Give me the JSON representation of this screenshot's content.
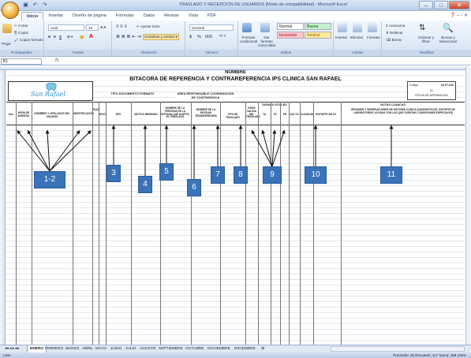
{
  "window": {
    "title": "TRASLADO Y RECEPCION DE USUARIOS [Modo de compatibilidad] - Microsoft Excel",
    "minimize": "–",
    "maximize": "□",
    "close": "✕"
  },
  "ribbon_tabs": [
    "Inicio",
    "Insertar",
    "Diseño de página",
    "Fórmulas",
    "Datos",
    "Revisar",
    "Vista",
    "PDF"
  ],
  "ribbon": {
    "clipboard": {
      "paste": "Pegar",
      "cut": "Cortar",
      "copy": "Copiar",
      "format_painter": "Copiar formato",
      "label": "Portapapeles"
    },
    "font": {
      "name": "Arial",
      "size": "10",
      "bold": "N",
      "italic": "K",
      "underline": "S",
      "label": "Fuente"
    },
    "alignment": {
      "wrap": "Ajustar texto",
      "merge": "Combinar y centrar",
      "label": "Alineación"
    },
    "number": {
      "format": "General",
      "currency": "$",
      "percent": "%",
      "thousands": "000",
      "label": "Número"
    },
    "styles": {
      "conditional": "Formato condicional",
      "as_table": "Dar formato como tabla",
      "normal": "Normal",
      "good": "Buena",
      "bad": "Incorrecto",
      "neutral": "Neutral",
      "label": "Estilos"
    },
    "cells": {
      "insert": "Insertar",
      "delete": "Eliminar",
      "format": "Formato",
      "label": "Celdas"
    },
    "editing": {
      "autosum": "Autosuma",
      "fill": "Rellenar",
      "clear": "Borrar",
      "sort": "Ordenar y filtrar",
      "find": "Buscar y seleccionar",
      "label": "Modificar"
    }
  },
  "formula_bar": {
    "cell": "B1",
    "fx": "fx",
    "value": ""
  },
  "sheet": {
    "title1": "NOMBRE",
    "title2": "BITACORA DE REFERENCIA  Y CONTRAREFERENCIA IPS CLINICA SAN RAFAEL",
    "logo_text": "San Rafael",
    "section_doc": "TIPO DOCUMENTO FORMATO",
    "section_unit": "AREA RESPONSABLE COORDINACION DE CONTINGENCIA",
    "section_signs": "SIGNOS VITALES",
    "section_notes": "NOTAS CLINICAS",
    "code_label": "Código",
    "code_value": "00-FT-022",
    "version": "01",
    "approval_date": "FECHA DE APROBACION",
    "columns": [
      "Nro",
      "HORA DE INGRESO",
      "NOMBRES Y APELLIDOS DEL USUARIO",
      "IDENTIFICACION",
      "EDAD",
      "SEXO",
      "EPS",
      "MOTIVO REMISION",
      "NOMBRE DE LA PERSONA DE LA ENTIDAD QUE ACEPTA EL TRASLADO",
      "NOMBRE DE LA ENTIDAD TRANSFERIDORA",
      "TIPO DE TRASLADO",
      "HORA SALIDA DEL TRASLADO",
      "TA",
      "FC",
      "FR",
      "SAT O2",
      "GLASGOW",
      "SOPORTE DE O2",
      "RESUMEN Y OBSERVACIONES DE HISTORIA CLINICA (DIAGNOSTICOS, SOPORTE DE LABORATORIOS, AYUDAS CON LAS QUE CUENTAN, CONDICIONES ESPECIALES)"
    ],
    "badges": [
      "1-2",
      "3",
      "4",
      "5",
      "6",
      "7",
      "8",
      "9",
      "10",
      "11"
    ]
  },
  "sheet_tabs": [
    "ENERO",
    "FEBRERO",
    "MARZO",
    "ABRIL",
    "MAYO",
    "JUNIO",
    "JULIO",
    "AGOSTO",
    "SEPTIEMBRE",
    "OCTUBRE",
    "NOVIEMBRE",
    "DICIEMBRE"
  ],
  "active_sheet": "ENERO",
  "status": {
    "left": "Listo",
    "right": "Promedio: 26    Recuento: 117    Suma: 468     100%"
  },
  "colors": {
    "badge": "#3a73b8",
    "ribbon": "#dde8f6",
    "bad_style": "#ffc7ce",
    "good_style": "#c6efce",
    "neutral_style": "#ffeb9c"
  }
}
